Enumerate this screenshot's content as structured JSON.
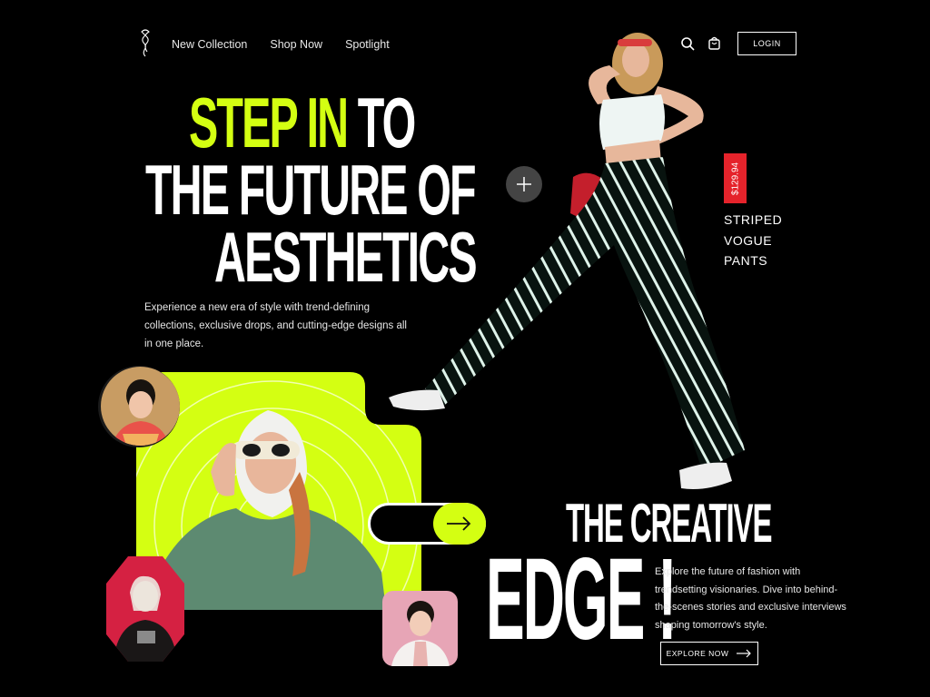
{
  "nav": {
    "items": [
      "New Collection",
      "Shop Now",
      "Spotlight"
    ],
    "login_label": "LOGIN"
  },
  "hero": {
    "headline_accent": "STEP IN",
    "headline_rest": "TO",
    "headline_line2": "THE FUTURE OF",
    "headline_line3": "AESTHETICS",
    "intro": "Experience a new era of style with trend-defining collections, exclusive drops, and cutting-edge designs all in one place."
  },
  "product": {
    "price": "$129.94",
    "name": "STRIPED VOGUE PANTS"
  },
  "feature": {
    "title_line1": "THE CREATIVE",
    "title_line2": "EDGE !",
    "description": "Explore the future of fashion with trendsetting visionaries. Dive into behind-the-scenes stories and exclusive interviews shaping tomorrow's style.",
    "cta_label": "EXPLORE NOW"
  },
  "colors": {
    "accent": "#d4ff12",
    "price_tag": "#e5232b",
    "background": "#000000"
  },
  "icons": [
    "logo-icon",
    "search-icon",
    "bag-icon",
    "plus-icon",
    "arrow-right-icon"
  ]
}
